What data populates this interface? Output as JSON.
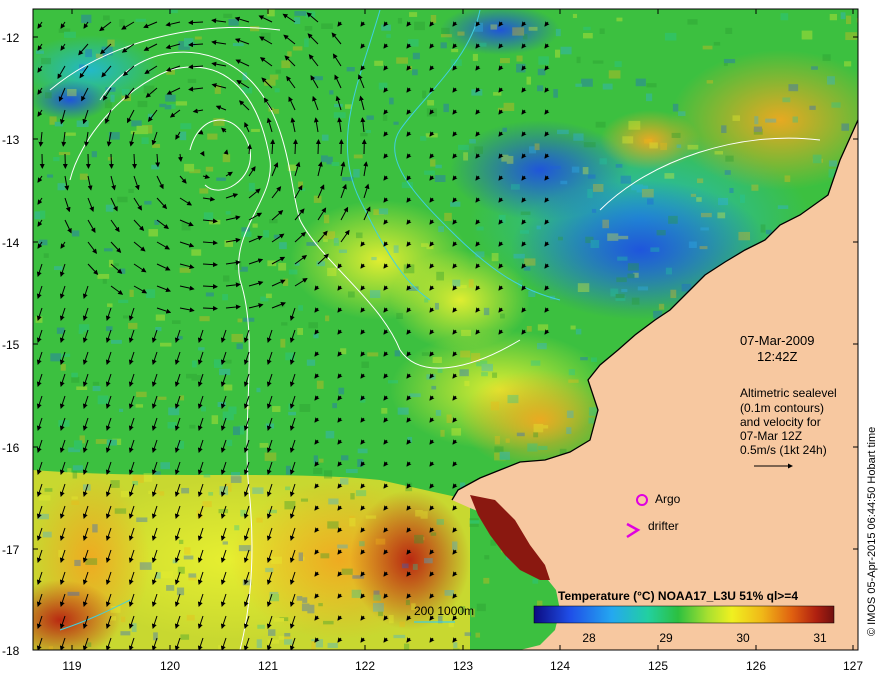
{
  "map": {
    "y_ticks": [
      "-12",
      "-13",
      "-14",
      "-15",
      "-16",
      "-17",
      "-18"
    ],
    "x_ticks": [
      "119",
      "120",
      "121",
      "122",
      "123",
      "124",
      "125",
      "126",
      "127"
    ],
    "lat_range": [
      -18,
      -11.8
    ],
    "lon_range": [
      118.6,
      127
    ]
  },
  "annotations": {
    "date": "07-Mar-2009",
    "time": "12:42Z",
    "altimetry_lines": [
      "Altimetric sealevel",
      "(0.1m contours)",
      "and velocity for",
      "07-Mar 12Z",
      "0.5m/s (1kt 24h)"
    ],
    "argo_label": "Argo",
    "drifter_label": "drifter",
    "depth_legend": "200  1000m"
  },
  "colorbar": {
    "title": "Temperature (°C) NOAA17_L3U 51% ql>=4",
    "ticks": [
      "28",
      "29",
      "30",
      "31"
    ],
    "range": [
      27.3,
      31.4
    ]
  },
  "credit": "© IMOS 05-Apr-2015 06:44:50 Hobart time",
  "colors": {
    "land": "#f7c8a0",
    "argo_marker": "#e000e0",
    "drifter_marker": "#e000e0",
    "depth_200": "#40d0e0",
    "depth_1000": "#40d0e0",
    "sealevel_contour": "#ffffff"
  }
}
